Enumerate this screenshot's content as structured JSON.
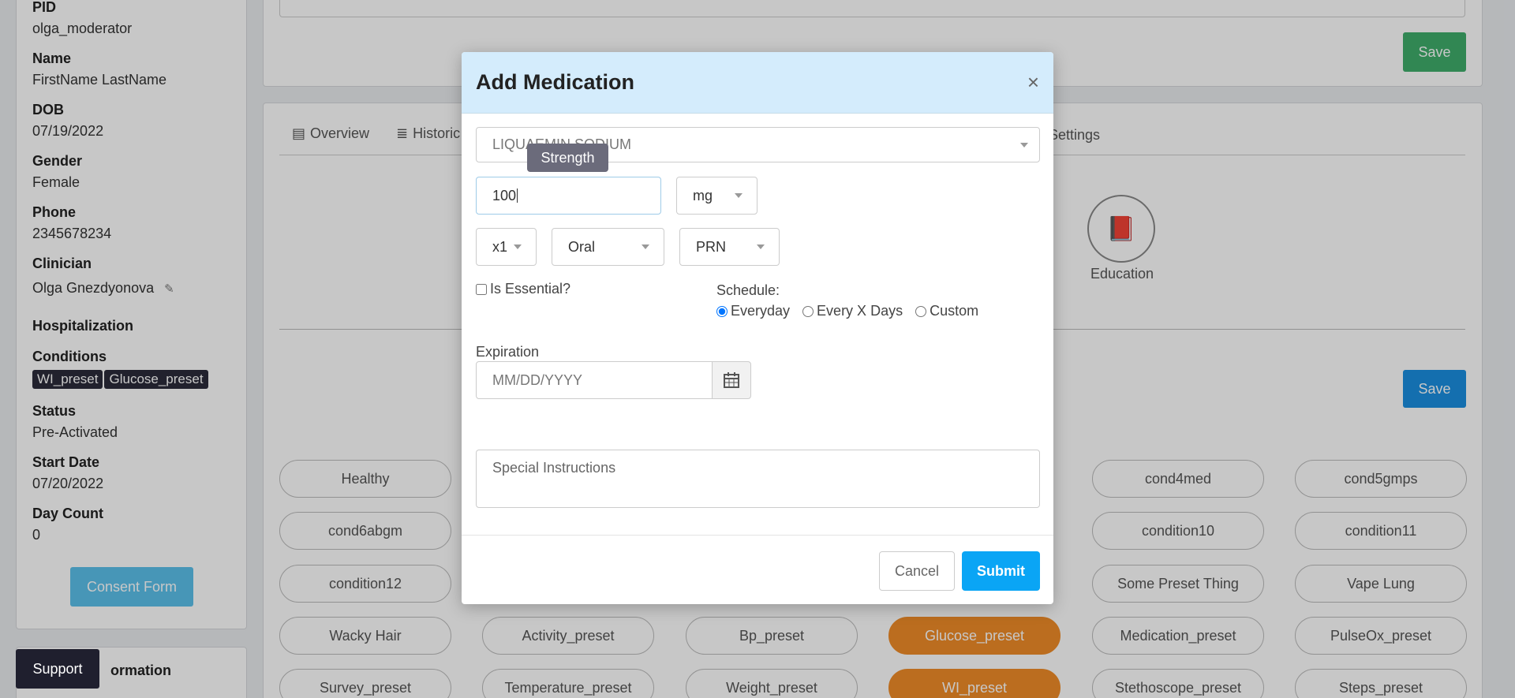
{
  "sidebar": {
    "pid_label": "PID",
    "pid_value": "olga_moderator",
    "name_label": "Name",
    "name_value": "FirstName LastName",
    "dob_label": "DOB",
    "dob_value": "07/19/2022",
    "gender_label": "Gender",
    "gender_value": "Female",
    "phone_label": "Phone",
    "phone_value": "2345678234",
    "clinician_label": "Clinician",
    "clinician_value": "Olga Gnezdyonova",
    "hospitalization_label": "Hospitalization",
    "conditions_label": "Conditions",
    "conditions": [
      "WI_preset",
      "Glucose_preset"
    ],
    "status_label": "Status",
    "status_value": "Pre-Activated",
    "start_date_label": "Start Date",
    "start_date_value": "07/20/2022",
    "day_count_label": "Day Count",
    "day_count_value": "0",
    "consent_button": "Consent Form",
    "info_heading": "ormation",
    "support_button": "Support"
  },
  "top": {
    "save_label": "Save"
  },
  "tabs": {
    "overview": "Overview",
    "historic": "Historic",
    "settings": "Settings"
  },
  "education": {
    "label": "Education"
  },
  "presets": {
    "save_label": "Save",
    "items": [
      "Healthy",
      "cond4med",
      "cond5gmps",
      "cond6abgm",
      "condition10",
      "condition11",
      "condition12",
      "Some Preset Thing",
      "Vape Lung",
      "Wacky Hair",
      "Activity_preset",
      "Bp_preset",
      "Glucose_preset",
      "Medication_preset",
      "PulseOx_preset",
      "Survey_preset",
      "Temperature_preset",
      "Weight_preset",
      "WI_preset",
      "Stethoscope_preset",
      "Steps_preset"
    ]
  },
  "modal": {
    "title": "Add Medication",
    "close": "×",
    "medication_value": "LIQUAEMIN SODIUM",
    "tooltip": "Strength",
    "strength_value": "100",
    "unit_value": "mg",
    "quantity_value": "x1",
    "route_value": "Oral",
    "frequency_value": "PRN",
    "essential_label": "Is Essential?",
    "schedule_label": "Schedule:",
    "schedule_options": [
      "Everyday",
      "Every X Days",
      "Custom"
    ],
    "expiration_label": "Expiration",
    "expiration_placeholder": "MM/DD/YYYY",
    "instructions_placeholder": "Special Instructions",
    "cancel_label": "Cancel",
    "submit_label": "Submit"
  },
  "colors": {
    "accent": "#0aa5f5",
    "active_preset": "#f08c28",
    "header_bg": "#d4ecfc",
    "save_green": "#3fae6b"
  }
}
